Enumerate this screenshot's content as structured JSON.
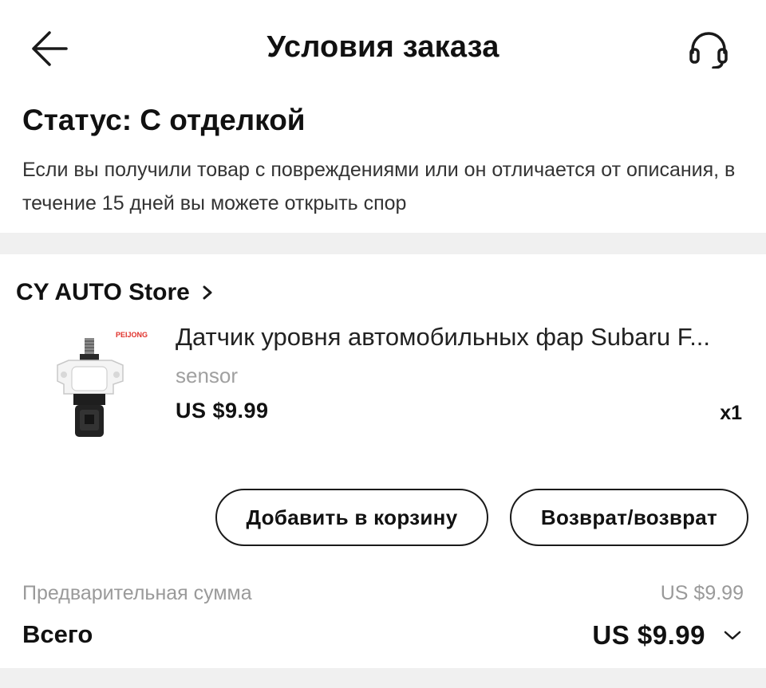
{
  "header": {
    "title": "Условия заказа",
    "back_icon": "arrow-left-icon",
    "support_icon": "headset-icon"
  },
  "status": {
    "title": "Статус: С отделкой",
    "description": "Если вы получили товар с повреждениями или он отличается от описания, в течение 15 дней вы можете открыть спор"
  },
  "store": {
    "name": "CY AUTO Store",
    "chevron_icon": "chevron-right-icon"
  },
  "product": {
    "image_brand": "PEIJONG",
    "title": "Датчик уровня автомобильных фар Subaru F...",
    "variant": "sensor",
    "price": "US $9.99",
    "quantity": "x1"
  },
  "actions": {
    "add_to_cart_label": "Добавить в корзину",
    "return_label": "Возврат/возврат"
  },
  "totals": {
    "subtotal_label": "Предварительная сумма",
    "subtotal_value": "US $9.99",
    "total_label": "Всего",
    "total_value": "US $9.99",
    "expand_icon": "chevron-down-icon"
  },
  "colors": {
    "text": "#111111",
    "muted": "#9a9a9a",
    "divider": "#f0f0f0",
    "image_brand": "#e0302a"
  }
}
